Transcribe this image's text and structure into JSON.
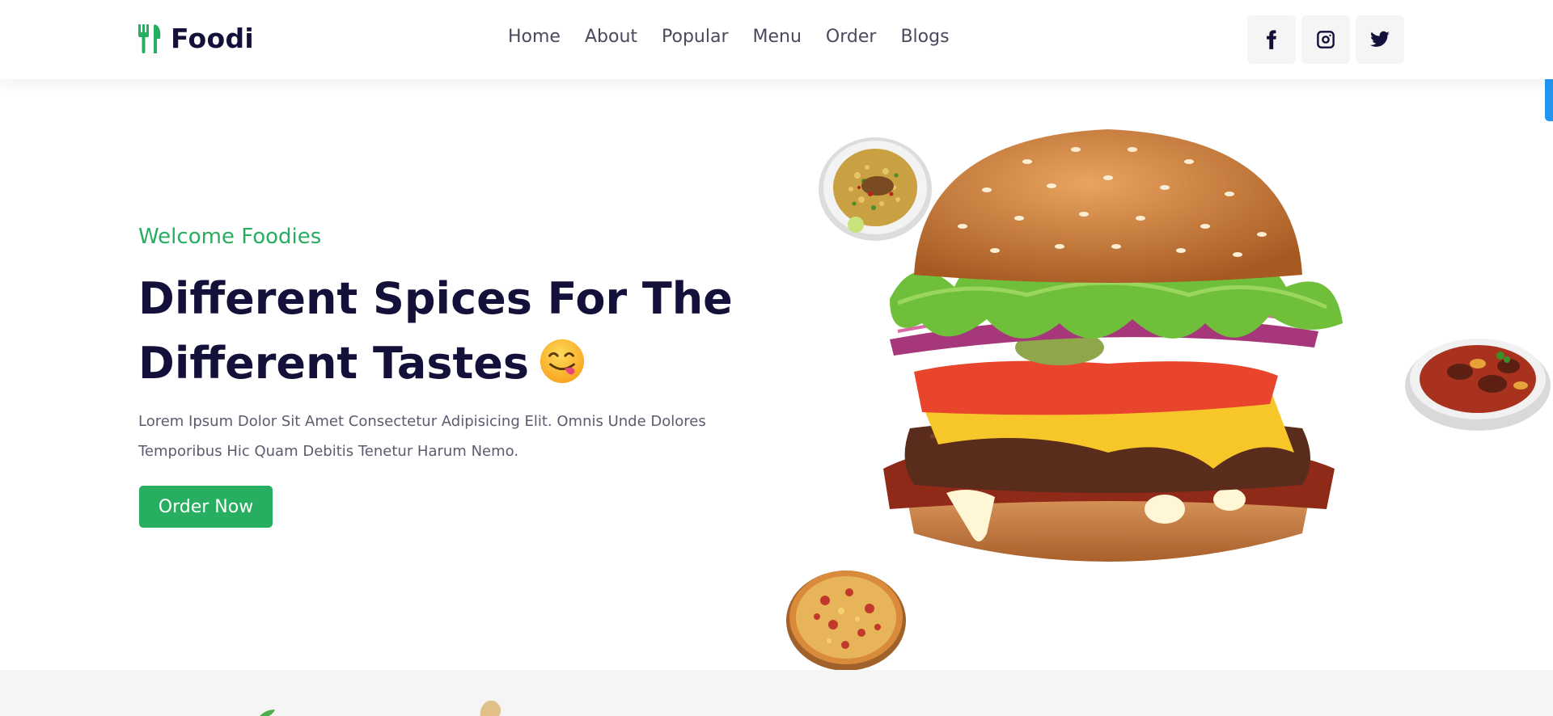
{
  "brand": {
    "name": "Foodi",
    "icon": "utensils-icon",
    "accent": "#27ae60"
  },
  "nav": {
    "items": [
      "Home",
      "About",
      "Popular",
      "Menu",
      "Order",
      "Blogs"
    ]
  },
  "socials": {
    "items": [
      "facebook-icon",
      "instagram-icon",
      "twitter-icon"
    ]
  },
  "hero": {
    "welcome": "Welcome Foodies",
    "headline_line1": "Different Spices For The",
    "headline_line2": "Different Tastes",
    "emoji": "face-savoring-food-emoji",
    "description": "Lorem Ipsum Dolor Sit Amet Consectetur Adipisicing Elit. Omnis Unde Dolores Temporibus Hic Quam Debitis Tenetur Harum Nemo.",
    "cta": "Order Now"
  },
  "images": [
    "rice-plate",
    "burger",
    "curry-bowl",
    "pizza"
  ],
  "colors": {
    "text": "#13103a",
    "accent": "#27ae60",
    "scroll_indicator": "#2196f3"
  }
}
